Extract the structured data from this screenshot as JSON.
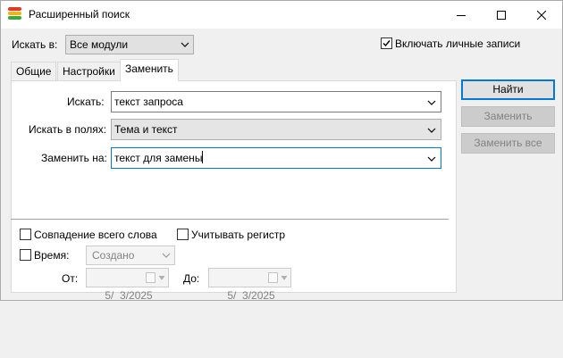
{
  "window": {
    "title": "Расширенный поиск",
    "icon": "app-stripes-icon"
  },
  "search_in": {
    "label": "Искать в:",
    "value": "Все модули"
  },
  "include_private": {
    "label": "Включать личные записи",
    "checked": true
  },
  "tabs": [
    {
      "label": "Общие",
      "active": false
    },
    {
      "label": "Настройки",
      "active": false
    },
    {
      "label": "Заменить",
      "active": true
    }
  ],
  "fields": {
    "search": {
      "label": "Искать:",
      "value": "текст запроса"
    },
    "search_in_fields": {
      "label": "Искать в полях:",
      "value": "Тема и текст"
    },
    "replace_with": {
      "label": "Заменить на:",
      "value": "текст для замены"
    }
  },
  "options": {
    "whole_word": {
      "label": "Совпадение всего слова",
      "checked": false
    },
    "match_case": {
      "label": "Учитывать регистр",
      "checked": false
    },
    "time": {
      "label": "Время:",
      "checked": false,
      "value": "Создано"
    },
    "from": {
      "label": "От:",
      "date": "5/  3/2025"
    },
    "to": {
      "label": "До:",
      "date": "5/  3/2025"
    }
  },
  "buttons": {
    "find": "Найти",
    "replace": "Заменить",
    "replace_all": "Заменить все"
  },
  "colors": {
    "accent": "#0078d7",
    "icon_stripes": [
      "#e0392b",
      "#f5b400",
      "#3aa845",
      "#1e88e5"
    ]
  }
}
